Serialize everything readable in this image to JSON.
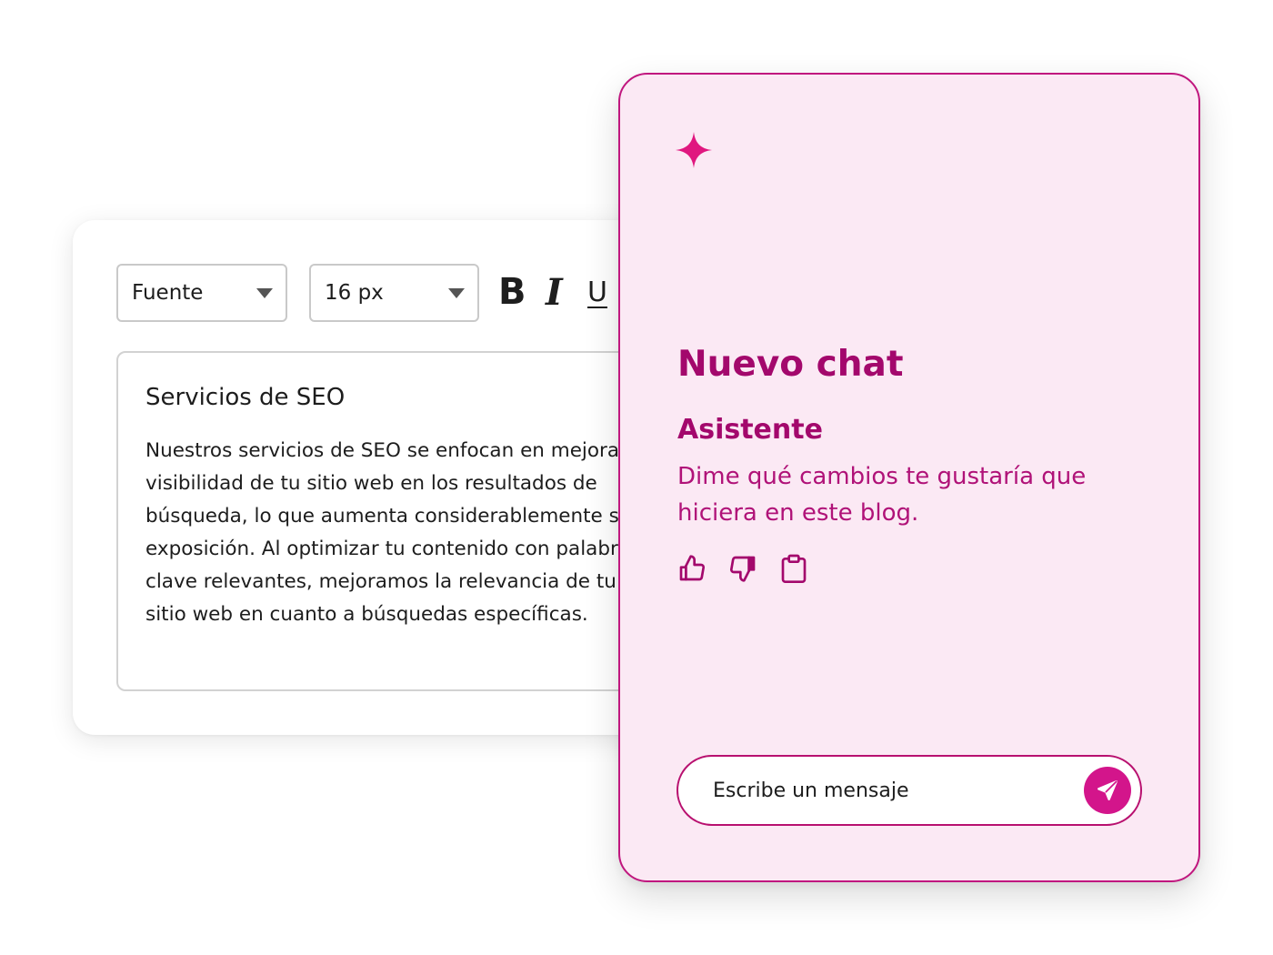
{
  "editor": {
    "font_select": {
      "value": "Fuente"
    },
    "size_select": {
      "value": "16 px"
    },
    "format": {
      "bold": "B",
      "italic": "I",
      "underline": "U"
    },
    "document": {
      "title": "Servicios de SEO",
      "body": "Nuestros servicios de SEO se enfocan en mejorar la visibilidad de tu sitio web en los resultados de búsqueda, lo que aumenta considerablemente su exposición. Al optimizar tu contenido con palabras clave relevantes, mejoramos la relevancia de tu sitio web en cuanto a búsquedas específicas."
    }
  },
  "chat": {
    "icon": "sparkle-icon",
    "title": "Nuevo chat",
    "assistant_label": "Asistente",
    "assistant_message": "Dime qué cambios te gustaría que hiciera en este blog.",
    "actions": [
      "thumbs-up-icon",
      "thumbs-down-icon",
      "clipboard-icon"
    ],
    "composer": {
      "placeholder": "Escribe un mensaje",
      "value": ""
    },
    "send_icon": "send-icon"
  },
  "colors": {
    "accent": "#a3086c",
    "sparkle": "#e0177f",
    "panel_bg": "#fbe9f4",
    "panel_border": "#c0167e",
    "send_button": "#d3158b"
  }
}
